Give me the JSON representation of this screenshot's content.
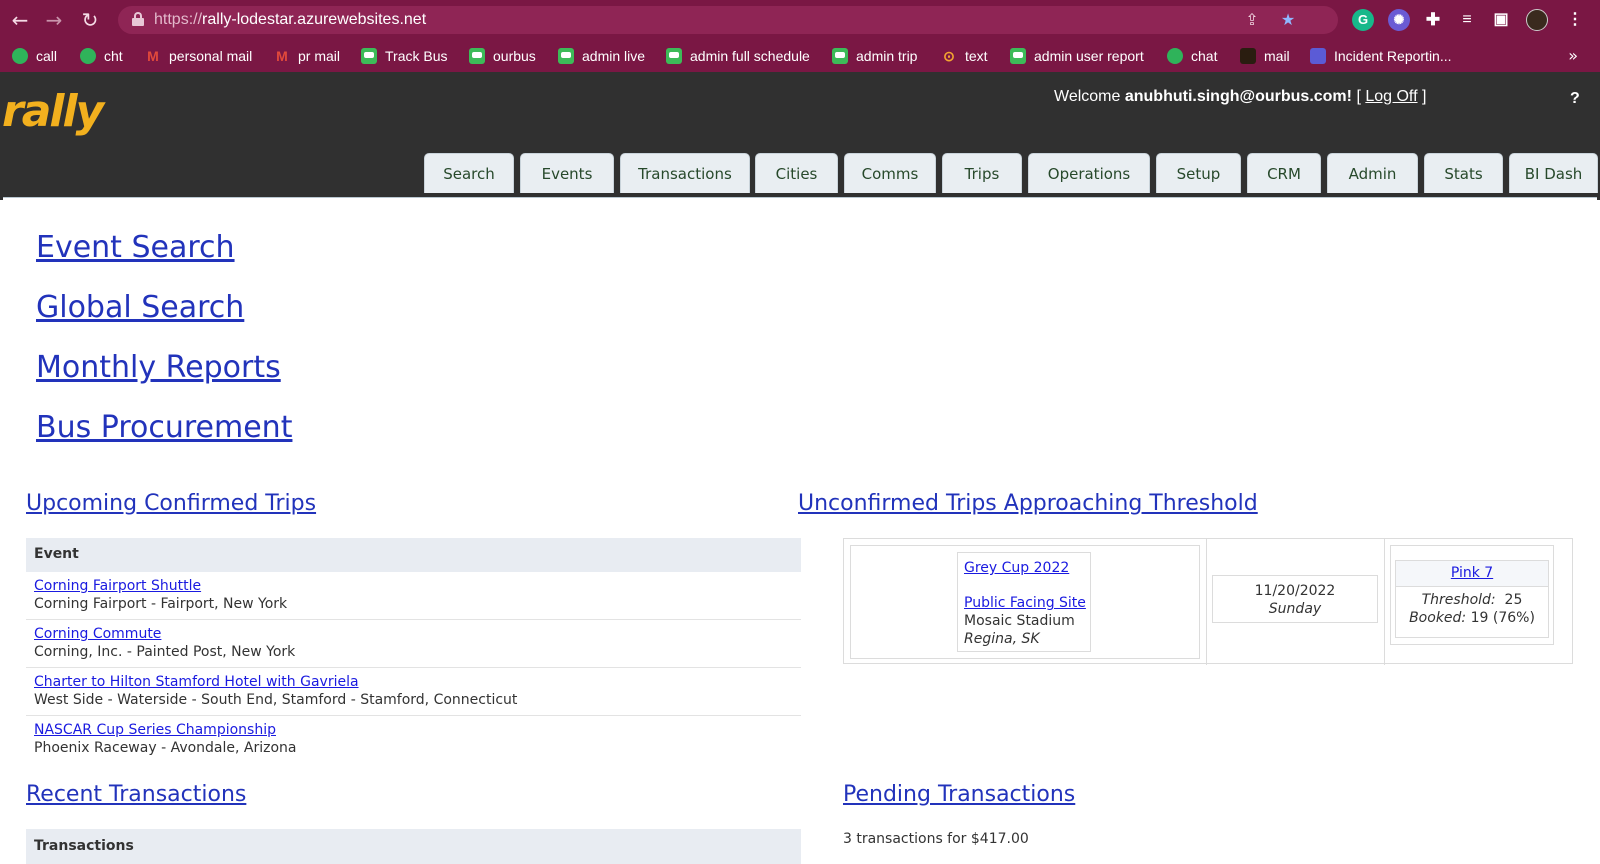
{
  "browser": {
    "url_scheme": "https://",
    "url_host": "rally-lodestar.azurewebsites.net",
    "bookmarks": [
      {
        "label": "call",
        "icon": "phone-icon"
      },
      {
        "label": "cht",
        "icon": "chat-icon"
      },
      {
        "label": "personal mail",
        "icon": "gmail-icon"
      },
      {
        "label": "pr mail",
        "icon": "gmail-icon"
      },
      {
        "label": "Track Bus",
        "icon": "bus-icon"
      },
      {
        "label": "ourbus",
        "icon": "bus-icon"
      },
      {
        "label": "admin live",
        "icon": "bus-icon"
      },
      {
        "label": "admin full schedule",
        "icon": "bus-icon"
      },
      {
        "label": "admin trip",
        "icon": "bus-icon"
      },
      {
        "label": "text",
        "icon": "text-icon"
      },
      {
        "label": "admin user report",
        "icon": "bus-icon"
      },
      {
        "label": "chat",
        "icon": "chat-icon"
      },
      {
        "label": "mail",
        "icon": "mail-icon"
      },
      {
        "label": "Incident Reportin...",
        "icon": "list-icon"
      }
    ],
    "more": "»"
  },
  "header": {
    "logo": "rally",
    "welcome_prefix": "Welcome",
    "user": "anubhuti.singh@ourbus.com!",
    "bracket_open": "[",
    "logoff": "Log Off",
    "bracket_close": "]",
    "help": "?"
  },
  "tabs": [
    "Search",
    "Events",
    "Transactions",
    "Cities",
    "Comms",
    "Trips",
    "Operations",
    "Setup",
    "CRM",
    "Admin",
    "Stats",
    "BI Dash"
  ],
  "links": {
    "event_search": "Event Search",
    "global_search": "Global Search",
    "monthly_reports": "Monthly Reports",
    "bus_procurement": "Bus Procurement"
  },
  "upcoming": {
    "title": "Upcoming Confirmed Trips",
    "column": "Event",
    "rows": [
      {
        "event": "Corning Fairport Shuttle",
        "location": "Corning Fairport - Fairport, New York"
      },
      {
        "event": "Corning Commute",
        "location": "Corning, Inc. - Painted Post, New York"
      },
      {
        "event": "Charter to Hilton Stamford Hotel with Gavriela",
        "location": "West Side - Waterside - South End, Stamford - Stamford, Connecticut"
      },
      {
        "event": "NASCAR Cup Series Championship",
        "location": "Phoenix Raceway - Avondale, Arizona"
      }
    ]
  },
  "unconfirmed": {
    "title": "Unconfirmed Trips Approaching Threshold",
    "event": "Grey Cup 2022",
    "site_link": "Public Facing Site",
    "venue": "Mosaic Stadium",
    "city": "Regina, SK",
    "date": "11/20/2022",
    "day": "Sunday",
    "route": "Pink 7",
    "threshold_label": "Threshold:",
    "threshold": "25",
    "booked_label": "Booked:",
    "booked": "19 (76%)"
  },
  "recent": {
    "title": "Recent Transactions",
    "column": "Transactions"
  },
  "pending": {
    "title": "Pending Transactions",
    "summary": "3 transactions for $417.00"
  }
}
